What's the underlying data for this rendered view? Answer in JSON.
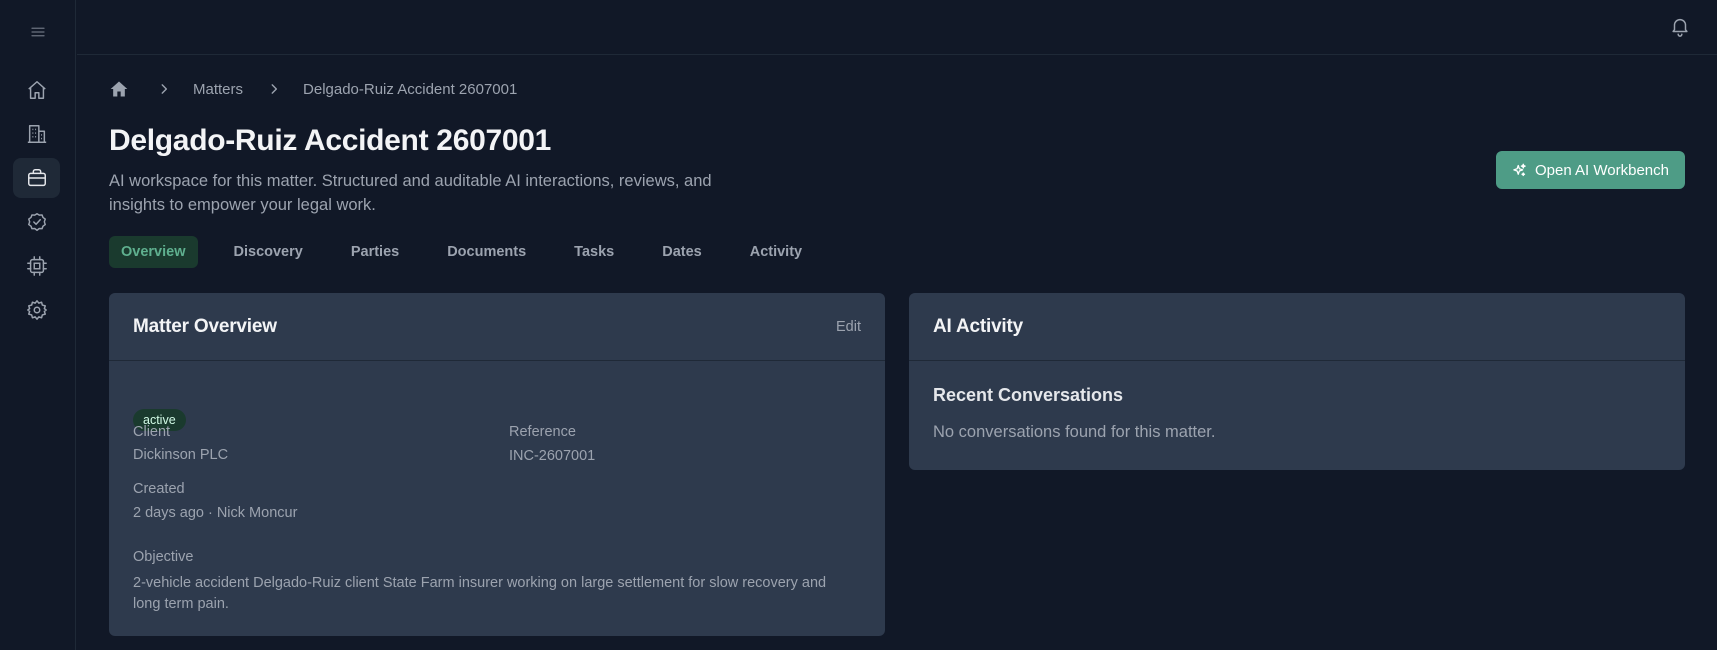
{
  "breadcrumb": {
    "items": [
      "Matters",
      "Delgado-Ruiz Accident 2607001"
    ]
  },
  "header": {
    "title": "Delgado-Ruiz Accident 2607001",
    "description": "AI workspace for this matter. Structured and auditable AI interactions, reviews, and insights to empower your legal work.",
    "ai_button_label": "Open AI Workbench"
  },
  "tabs": [
    {
      "label": "Overview",
      "active": true
    },
    {
      "label": "Discovery"
    },
    {
      "label": "Parties"
    },
    {
      "label": "Documents"
    },
    {
      "label": "Tasks"
    },
    {
      "label": "Dates"
    },
    {
      "label": "Activity"
    }
  ],
  "overview": {
    "title": "Matter Overview",
    "edit_label": "Edit",
    "status": "active",
    "client_label": "Client",
    "client_value": "Dickinson PLC",
    "reference_label": "Reference",
    "reference_value": "INC-2607001",
    "created_label": "Created",
    "created_value": "2 days ago · Nick Moncur",
    "objective_label": "Objective",
    "objective_value": "2-vehicle accident Delgado-Ruiz client State Farm insurer working on large settlement for slow recovery and long term pain."
  },
  "ai_activity": {
    "title": "AI Activity",
    "recent_title": "Recent Conversations",
    "empty_message": "No conversations found for this matter."
  },
  "icons": {
    "sidebar": [
      "menu-icon",
      "home-icon",
      "building-icon",
      "briefcase-icon",
      "check-circle-icon",
      "cpu-icon",
      "gear-icon"
    ],
    "topbar": "bell-icon",
    "ai_button": "sparkles-icon"
  },
  "colors": {
    "background": "#111827",
    "card": "#2e3a4d",
    "accent": "#4e9c86",
    "active_tab_bg": "#1a3a2e",
    "active_tab_text": "#5fb08f"
  }
}
